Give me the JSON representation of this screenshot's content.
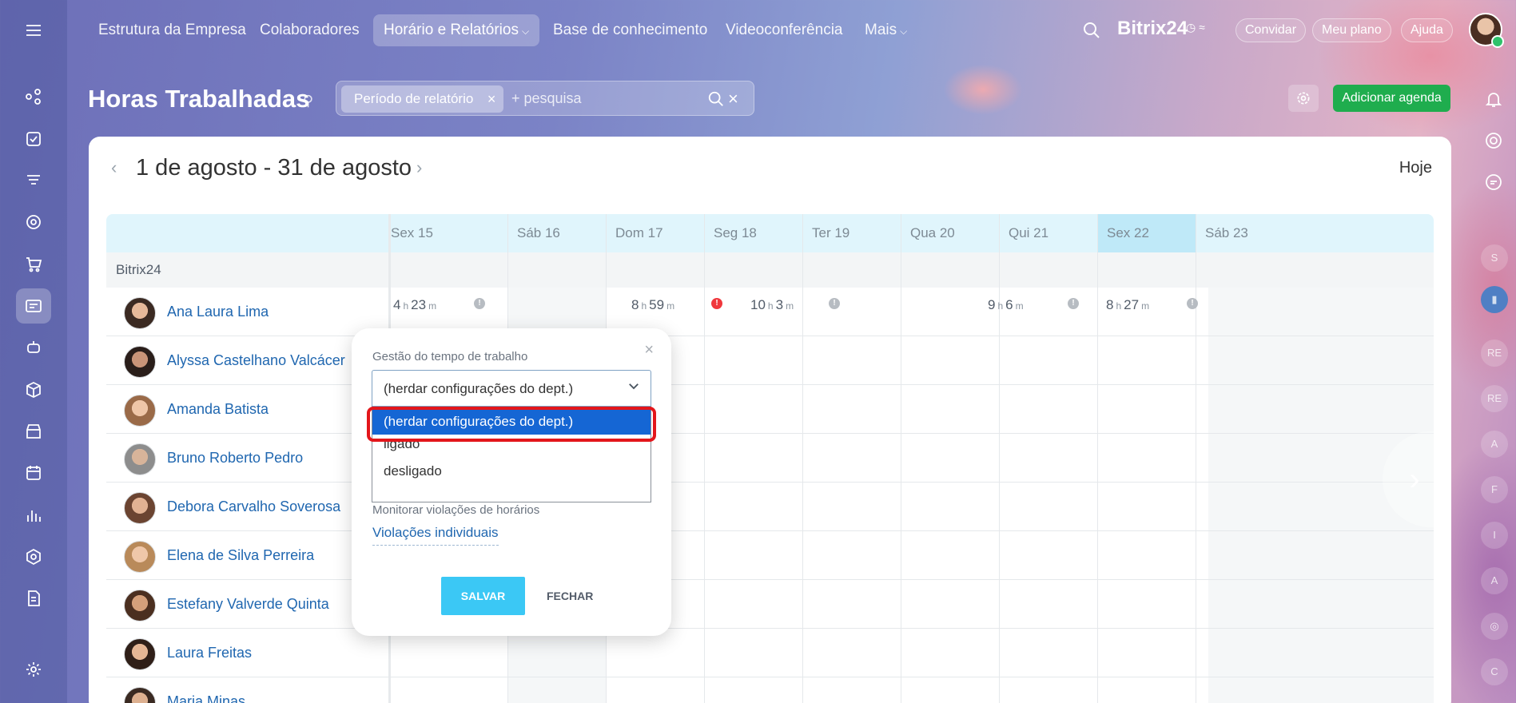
{
  "nav": {
    "items": [
      {
        "label": "Estrutura da Empresa"
      },
      {
        "label": "Colaboradores"
      },
      {
        "label": "Horário e Relatórios"
      },
      {
        "label": "Base de conhecimento"
      },
      {
        "label": "Videoconferência"
      },
      {
        "label": "Mais"
      }
    ],
    "brand": "Bitrix24",
    "invite": "Convidar",
    "plan": "Meu plano",
    "help": "Ajuda"
  },
  "header": {
    "title": "Horas Trabalhadas",
    "filter_tag": "Período de relatório",
    "search_placeholder": "+ pesquisa",
    "add_button": "Adicionar agenda"
  },
  "calendar": {
    "range": "1 de agosto - 31 de agosto",
    "today": "Hoje",
    "dept": "Bitrix24",
    "days": [
      "Sex 15",
      "Sáb 16",
      "Dom 17",
      "Seg 18",
      "Ter 19",
      "Qua 20",
      "Qui 21",
      "Sex 22",
      "Sáb 23"
    ],
    "employees": [
      {
        "name": "Ana Laura Lima"
      },
      {
        "name": "Alyssa Castelhano Valcácer"
      },
      {
        "name": "Amanda Batista"
      },
      {
        "name": "Bruno Roberto Pedro"
      },
      {
        "name": "Debora Carvalho Soverosa"
      },
      {
        "name": "Elena de Silva Perreira"
      },
      {
        "name": "Estefany Valverde Quinta"
      },
      {
        "name": "Laura Freitas"
      },
      {
        "name": "Maria Minas"
      }
    ],
    "first_row_cells": [
      {
        "h": "4",
        "m": "23"
      },
      {
        "h": "8",
        "m": "59"
      },
      {
        "h": "10",
        "m": "3"
      },
      {
        "h": "9",
        "m": "6"
      },
      {
        "h": "8",
        "m": "27"
      }
    ],
    "unit_h": "h",
    "unit_m": "m"
  },
  "popup": {
    "label": "Gestão do tempo de trabalho",
    "selected": "(herdar configurações do dept.)",
    "options": [
      "(herdar configurações do dept.)",
      "ligado",
      "desligado"
    ],
    "label2": "Monitorar violações de horários",
    "link": "Violações individuais",
    "save": "SALVAR",
    "close": "FECHAR"
  },
  "right_rail": [
    "S",
    "RE",
    "RE",
    "A",
    "F",
    "I",
    "A",
    "C"
  ],
  "colors": {
    "accent": "#1fad4e",
    "selected_option": "#1566d4",
    "highlight": "#e3161b",
    "save": "#3bc8f5"
  }
}
